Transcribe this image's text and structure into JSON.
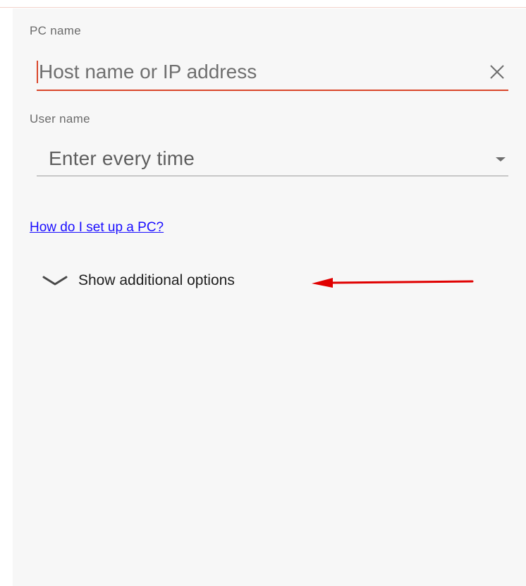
{
  "pc_name": {
    "label": "PC name",
    "placeholder": "Host name or IP address",
    "value": ""
  },
  "user_name": {
    "label": "User name",
    "selected": "Enter every time"
  },
  "help_link": {
    "text": "How do I set up a PC?"
  },
  "additional_options": {
    "label": "Show additional options"
  },
  "colors": {
    "accent": "#d9472b",
    "link": "#1a0dff",
    "annotation_arrow": "#e00000",
    "background": "#f7f7f7"
  },
  "icons": {
    "clear": "close-icon",
    "dropdown": "dropdown-arrow-icon",
    "expander": "chevron-down-icon",
    "annotation": "red-arrow-annotation"
  }
}
